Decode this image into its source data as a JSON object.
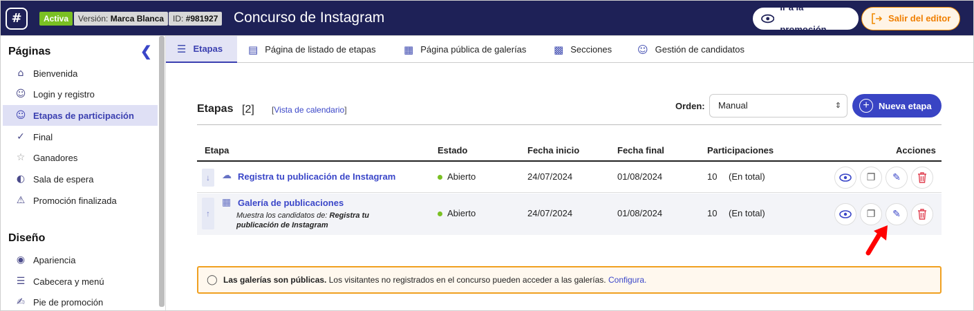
{
  "header": {
    "logo_glyph": "#",
    "status_badge": "Activa",
    "version_label": "Versión:",
    "version_value": "Marca Blanca",
    "id_label": "ID:",
    "id_value": "#981927",
    "title": "Concurso de Instagram",
    "promo_button": "Ir a la promoción",
    "exit_button": "Salir del editor"
  },
  "sidebar": {
    "pages_heading": "Páginas",
    "design_heading": "Diseño",
    "pages": [
      {
        "label": "Bienvenida",
        "icon": "home-icon"
      },
      {
        "label": "Login y registro",
        "icon": "user-login-icon"
      },
      {
        "label": "Etapas de participación",
        "icon": "user-stages-icon",
        "selected": true
      },
      {
        "label": "Final",
        "icon": "check-icon"
      },
      {
        "label": "Ganadores",
        "icon": "trophy-icon"
      },
      {
        "label": "Sala de espera",
        "icon": "gauge-icon"
      },
      {
        "label": "Promoción finalizada",
        "icon": "warning-icon"
      }
    ],
    "design": [
      {
        "label": "Apariencia",
        "icon": "palette-icon"
      },
      {
        "label": "Cabecera y menú",
        "icon": "menu-icon"
      },
      {
        "label": "Pie de promoción",
        "icon": "footer-icon"
      }
    ]
  },
  "tabs": [
    {
      "label": "Etapas",
      "icon": "stack-icon",
      "selected": true
    },
    {
      "label": "Página de listado de etapas",
      "icon": "clipboard-icon"
    },
    {
      "label": "Página pública de galerías",
      "icon": "grid-icon"
    },
    {
      "label": "Secciones",
      "icon": "sections-icon"
    },
    {
      "label": "Gestión de candidatos",
      "icon": "candidates-icon"
    }
  ],
  "main": {
    "heading": "Etapas",
    "count": "[2]",
    "calendar_link": "Vista de calendario",
    "order_label": "Orden:",
    "order_value": "Manual",
    "new_button": "Nueva etapa",
    "columns": {
      "stage": "Etapa",
      "status": "Estado",
      "start": "Fecha inicio",
      "end": "Fecha final",
      "participations": "Participaciones",
      "actions": "Acciones"
    },
    "rows": [
      {
        "handle": "↓",
        "name": "Registra tu publicación de Instagram",
        "status": "Abierto",
        "start": "24/07/2024",
        "end": "01/08/2024",
        "count": "10",
        "count_note": "(En total)"
      },
      {
        "handle": "↑",
        "name": "Galería de publicaciones",
        "subtitle_prefix": "Muestra los candidatos de:",
        "subtitle_ref": "Registra tu publicación de Instagram",
        "status": "Abierto",
        "start": "24/07/2024",
        "end": "01/08/2024",
        "count": "10",
        "count_note": "(En total)"
      }
    ],
    "notice": {
      "bold": "Las galerías son públicas.",
      "text": "Los visitantes no registrados en el concurso pueden acceder a las galerías.",
      "link": "Configura."
    }
  },
  "colors": {
    "header_bg": "#1e2157",
    "accent": "#3944c4",
    "active_badge": "#7ac023",
    "exit_orange": "#f08a00",
    "delete_red": "#e04050",
    "annotation_arrow": "#ff0000"
  }
}
